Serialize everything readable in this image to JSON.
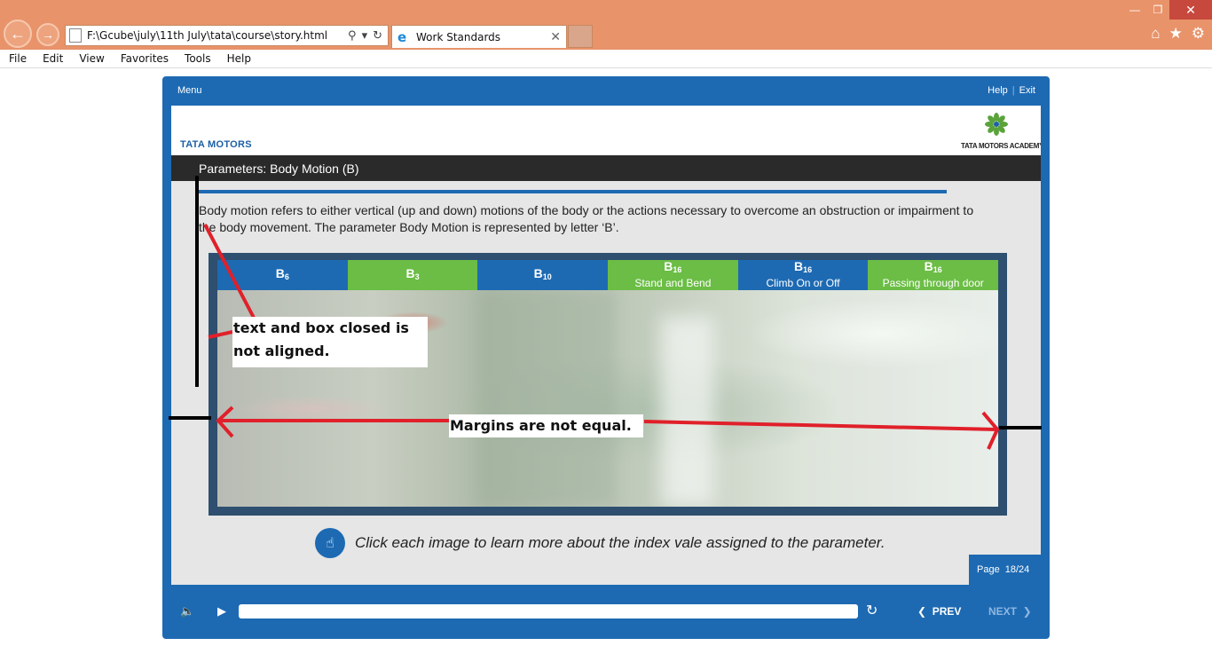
{
  "browser": {
    "address": "F:\\Gcube\\july\\11th July\\tata\\course\\story.html",
    "tab_title": "Work Standards",
    "menu": [
      "File",
      "Edit",
      "View",
      "Favorites",
      "Tools",
      "Help"
    ]
  },
  "player": {
    "menu_label": "Menu",
    "help_label": "Help",
    "separator": "|",
    "exit_label": "Exit"
  },
  "branding": {
    "company": "TATA MOTORS",
    "academy": "TATA MOTORS ACADEMY"
  },
  "slide": {
    "title": "Parameters: Body Motion (B)",
    "body": "Body motion refers to either vertical (up and down) motions of the body or the actions necessary to overcome an obstruction or impairment to the body movement. The parameter Body Motion is represented by letter ‘B’.",
    "tabs": [
      {
        "letter": "B",
        "index": "6",
        "label": "",
        "color": "#1d6ab3"
      },
      {
        "letter": "B",
        "index": "3",
        "label": "",
        "color": "#6bbd45"
      },
      {
        "letter": "B",
        "index": "10",
        "label": "",
        "color": "#1d6ab3"
      },
      {
        "letter": "B",
        "index": "16",
        "label": "Stand and Bend",
        "color": "#6bbd45"
      },
      {
        "letter": "B",
        "index": "16",
        "label": "Climb On or Off",
        "color": "#1d6ab3"
      },
      {
        "letter": "B",
        "index": "16",
        "label": "Passing through door",
        "color": "#6bbd45"
      }
    ],
    "hint": "Click each image to learn more about the index vale assigned to the parameter.",
    "page_label": "Page",
    "page_value": "18/24"
  },
  "controls": {
    "prev_label": "PREV",
    "next_label": "NEXT"
  },
  "annotations": {
    "note1": "text and box closed is not aligned.",
    "note2": "Margins are not equal."
  },
  "colors": {
    "brand_blue": "#1d6ab3",
    "tab_green": "#6bbd45",
    "annotation_red": "#e0202a",
    "chrome_orange": "#e8936a"
  }
}
